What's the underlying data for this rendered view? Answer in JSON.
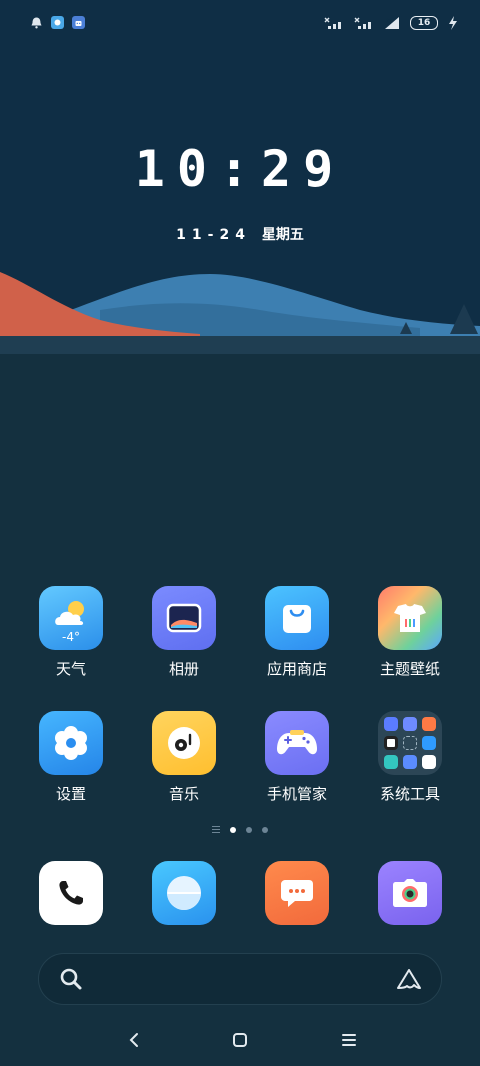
{
  "status_bar": {
    "left_icons": [
      "bell-icon",
      "app-notification-icon",
      "robot-notification-icon"
    ],
    "right_icons": [
      "signal-sim1-icon",
      "signal-sim2-icon",
      "wifi-icon",
      "battery-icon",
      "charging-icon"
    ],
    "battery_level": "16"
  },
  "lockclock": {
    "time": "10:29",
    "date": "11-24",
    "weekday": "星期五"
  },
  "apps": [
    {
      "label": "天气",
      "icon": "weather-icon",
      "temp": "-4°"
    },
    {
      "label": "相册",
      "icon": "gallery-icon"
    },
    {
      "label": "应用商店",
      "icon": "app-store-icon"
    },
    {
      "label": "主题壁纸",
      "icon": "theme-wallpaper-icon"
    },
    {
      "label": "设置",
      "icon": "settings-gear-icon"
    },
    {
      "label": "音乐",
      "icon": "music-icon"
    },
    {
      "label": "手机管家",
      "icon": "phone-manager-icon"
    },
    {
      "label": "系统工具",
      "icon": "system-tools-folder-icon"
    }
  ],
  "pager": {
    "pages": 3,
    "active": 0
  },
  "dock": [
    {
      "name": "phone",
      "icon": "phone-icon"
    },
    {
      "name": "browser",
      "icon": "browser-icon"
    },
    {
      "name": "messages",
      "icon": "message-icon"
    },
    {
      "name": "camera",
      "icon": "camera-icon"
    }
  ],
  "search": {
    "left_icon": "search-icon",
    "right_icon": "assistant-icon"
  },
  "navbar": [
    "back-icon",
    "home-icon",
    "menu-icon"
  ],
  "colors": {
    "background": "#14303f",
    "sky": "#0f2e45",
    "hill_red": "#d0614a",
    "hill_blue": "#3d7fb1"
  }
}
